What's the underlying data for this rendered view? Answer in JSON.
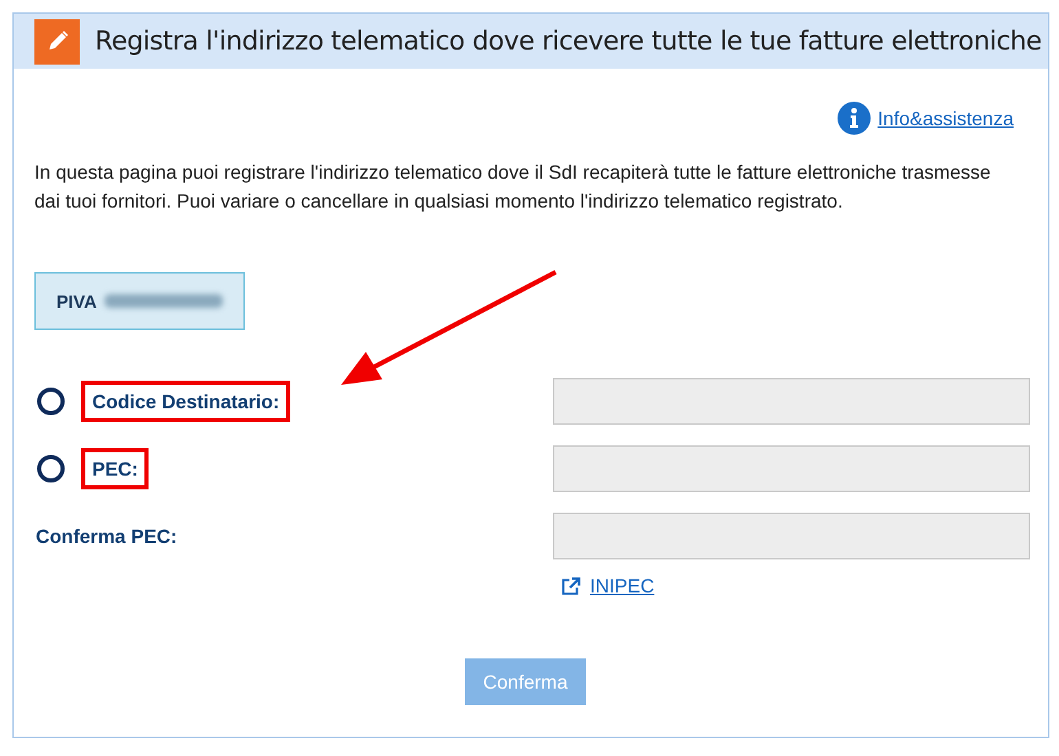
{
  "header": {
    "title": "Registra l'indirizzo telematico dove ricevere tutte le tue fatture elettroniche"
  },
  "help_link": {
    "label": "Info&assistenza"
  },
  "intro": "In questa pagina puoi registrare l'indirizzo telematico dove il SdI recapiterà tutte le fatture elettroniche trasmesse dai tuoi fornitori. Puoi variare o cancellare in qualsiasi momento l'indirizzo telematico registrato.",
  "piva": {
    "label": "PIVA",
    "value_redacted": true
  },
  "fields": [
    {
      "kind": "radio",
      "label": "Codice Destinatario:",
      "selected": false,
      "highlighted": true
    },
    {
      "kind": "radio",
      "label": "PEC:",
      "selected": false,
      "highlighted": true
    },
    {
      "kind": "plain",
      "label": "Conferma PEC:"
    }
  ],
  "inipec_link": {
    "label": "INIPEC"
  },
  "annotation_arrow": true,
  "submit_button": {
    "label": "Conferma",
    "disabled": true
  }
}
